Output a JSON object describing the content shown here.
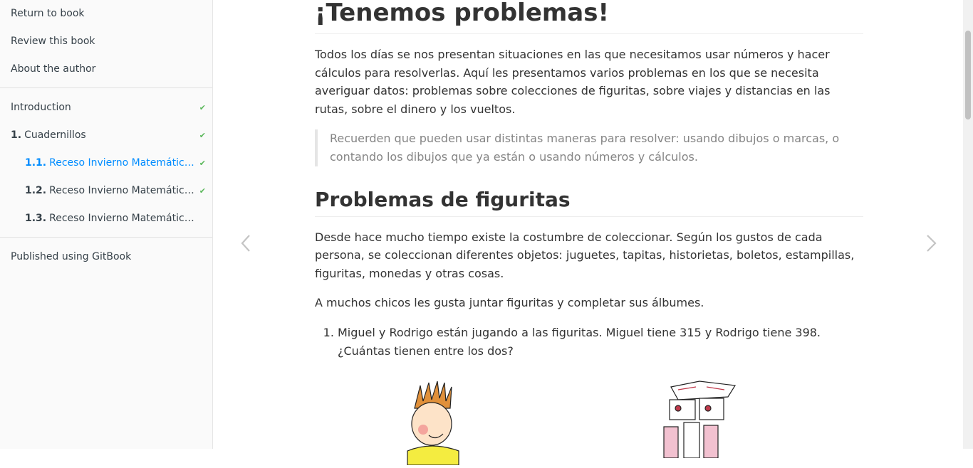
{
  "sidebar": {
    "top_links": [
      {
        "label": "Return to book"
      },
      {
        "label": "Review this book"
      },
      {
        "label": "About the author"
      }
    ],
    "chapters": [
      {
        "number": "",
        "label": "Introduction",
        "done": true
      },
      {
        "number": "1.",
        "label": "Cuadernillos",
        "done": true
      },
      {
        "number": "1.1.",
        "label": "Receso Invierno Matemática Rojo",
        "done": true,
        "active": true
      },
      {
        "number": "1.2.",
        "label": "Receso Invierno Matemática Azul",
        "done": true
      },
      {
        "number": "1.3.",
        "label": "Receso Invierno Matemática Verde",
        "done": false
      }
    ],
    "published": "Published using GitBook",
    "check_icon": "✔"
  },
  "page": {
    "title": "¡Tenemos problemas!",
    "intro": "Todos los días se nos presentan situaciones en las que necesitamos usar números y hacer cálculos para resolverlas. Aquí les presentamos varios problemas en los que se necesita averiguar datos: problemas sobre colecciones de figuritas, sobre viajes y distancias en las rutas, sobre el dinero y los vueltos.",
    "quote": "Recuerden que pueden usar distintas maneras para resolver: usando dibujos o marcas, o contando los dibujos que ya están o usando números y cálculos.",
    "section_title": "Problemas de figuritas",
    "section_p1": "Desde hace mucho tiempo existe la costumbre de coleccionar. Según los gustos de cada persona, se coleccionan diferentes objetos: juguetes, tapitas, historietas, boletos, estampillas, figuritas, monedas y otras cosas.",
    "section_p2": "A muchos chicos les gusta juntar figuritas y completar sus álbumes.",
    "problems": [
      "Miguel y Rodrigo están jugando a las figuritas. Miguel tiene 315 y Rodrigo tiene 398. ¿Cuántas tienen entre los dos?"
    ]
  },
  "colors": {
    "accent": "#008cff",
    "check": "#5cb85c",
    "text": "#333333",
    "sidebar_bg": "#fafafa"
  }
}
